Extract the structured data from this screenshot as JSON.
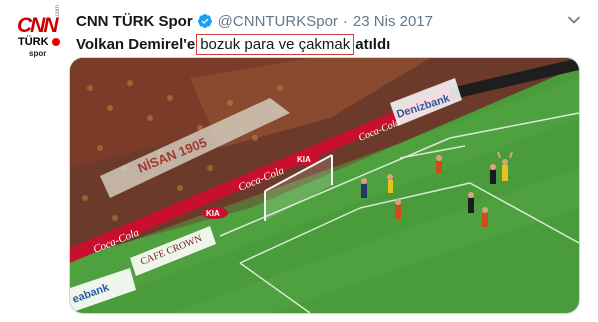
{
  "account": {
    "name": "CNN TÜRK Spor",
    "handle": "@CNNTURKSpor",
    "date": "23 Nis 2017"
  },
  "avatar": {
    "logo_top": "CNN",
    "logo_mid": "TÜRK",
    "logo_side": ".com",
    "logo_bottom": "spor"
  },
  "tweet": {
    "part1": "Volkan Demirel'e",
    "highlight": "bozuk para ve çakmak",
    "part2": "atıldı"
  },
  "media": {
    "boards": {
      "coke": "Coca-Cola",
      "kia": "KIA",
      "crown": "CAFE CROWN",
      "bank": "Denizbank",
      "eabank": "eabank",
      "banner": "NİSAN 1905"
    }
  },
  "colors": {
    "verified": "#1da1f2",
    "highlight_border": "#d23b3b",
    "pitch": "#4a9b3a",
    "crowd": "#6b3a2a",
    "board_red": "#c8102e"
  }
}
